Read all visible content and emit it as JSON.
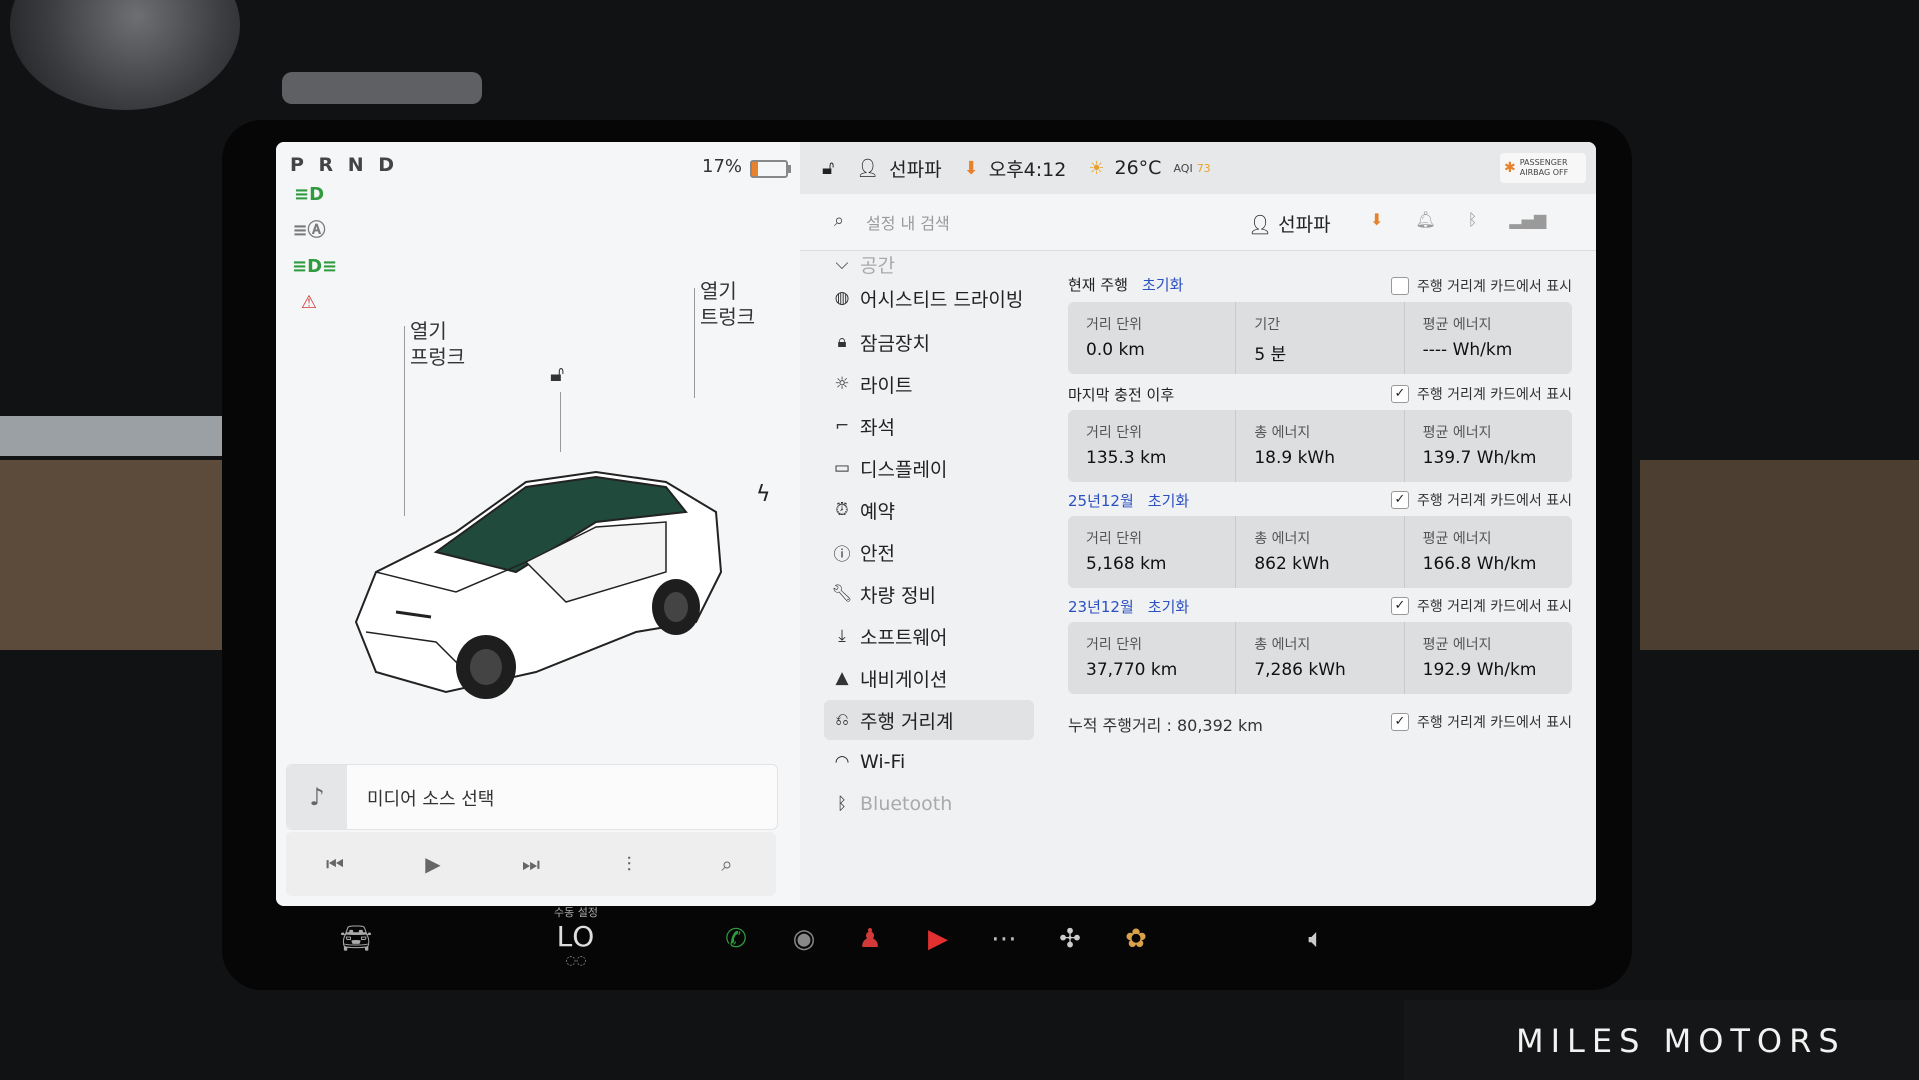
{
  "status": {
    "gear": "P R N D",
    "battery_percent": "17%",
    "battery_level": 0.17,
    "profile": "선파파",
    "time": "오후4:12",
    "temperature": "26°C",
    "aqi_label": "AQI",
    "aqi_value": "73",
    "airbag_line1": "PASSENGER",
    "airbag_line2": "AIRBAG OFF"
  },
  "car": {
    "frunk_label_1": "열기",
    "frunk_label_2": "프렁크",
    "trunk_label_1": "열기",
    "trunk_label_2": "트렁크"
  },
  "media": {
    "source_label": "미디어 소스 선택"
  },
  "search": {
    "placeholder": "설정 내 검색",
    "profile": "선파파"
  },
  "nav": {
    "items": [
      {
        "label": "공간",
        "icon": "hanger-icon"
      },
      {
        "label": "어시스티드 드라이빙",
        "icon": "steering-wheel-icon"
      },
      {
        "label": "잠금장치",
        "icon": "lock-icon"
      },
      {
        "label": "라이트",
        "icon": "light-icon"
      },
      {
        "label": "좌석",
        "icon": "seat-icon"
      },
      {
        "label": "디스플레이",
        "icon": "display-icon"
      },
      {
        "label": "예약",
        "icon": "alarm-clock-icon"
      },
      {
        "label": "안전",
        "icon": "safety-icon"
      },
      {
        "label": "차량 정비",
        "icon": "wrench-icon"
      },
      {
        "label": "소프트웨어",
        "icon": "download-icon"
      },
      {
        "label": "내비게이션",
        "icon": "navigation-icon"
      },
      {
        "label": "주행 거리계",
        "icon": "trip-icon"
      },
      {
        "label": "Wi-Fi",
        "icon": "wifi-icon"
      },
      {
        "label": "Bluetooth",
        "icon": "bluetooth-icon"
      }
    ],
    "active_index": 11
  },
  "trips": {
    "show_label": "주행 거리계 카드에서 표시",
    "reset_label": "초기화",
    "current": {
      "title": "현재 주행",
      "shown": false,
      "stats": [
        {
          "label": "거리 단위",
          "value": "0.0 km"
        },
        {
          "label": "기간",
          "value": "5 분"
        },
        {
          "label": "평균 에너지",
          "value": "---- Wh/km"
        }
      ]
    },
    "since_charge": {
      "title": "마지막 충전 이후",
      "shown": true,
      "stats": [
        {
          "label": "거리 단위",
          "value": "135.3 km"
        },
        {
          "label": "총 에너지",
          "value": "18.9 kWh"
        },
        {
          "label": "평균 에너지",
          "value": "139.7 Wh/km"
        }
      ]
    },
    "trip_a": {
      "title": "25년12월",
      "shown": true,
      "stats": [
        {
          "label": "거리 단위",
          "value": "5,168 km"
        },
        {
          "label": "총 에너지",
          "value": "862 kWh"
        },
        {
          "label": "평균 에너지",
          "value": "166.8 Wh/km"
        }
      ]
    },
    "trip_b": {
      "title": "23년12월",
      "shown": true,
      "stats": [
        {
          "label": "거리 단위",
          "value": "37,770 km"
        },
        {
          "label": "총 에너지",
          "value": "7,286 kWh"
        },
        {
          "label": "평균 에너지",
          "value": "192.9 Wh/km"
        }
      ]
    },
    "odometer_label": "누적 주행거리 : 80,392 km",
    "odometer_shown": true
  },
  "dock": {
    "climate_sub": "수동 설정",
    "climate_value": "LO"
  },
  "watermark": "MILES MOTORS",
  "colors": {
    "accent_orange": "#e8822a",
    "link_blue": "#2b50c0",
    "indicator_green": "#2f9a3e",
    "alert_red": "#d23a3a"
  }
}
